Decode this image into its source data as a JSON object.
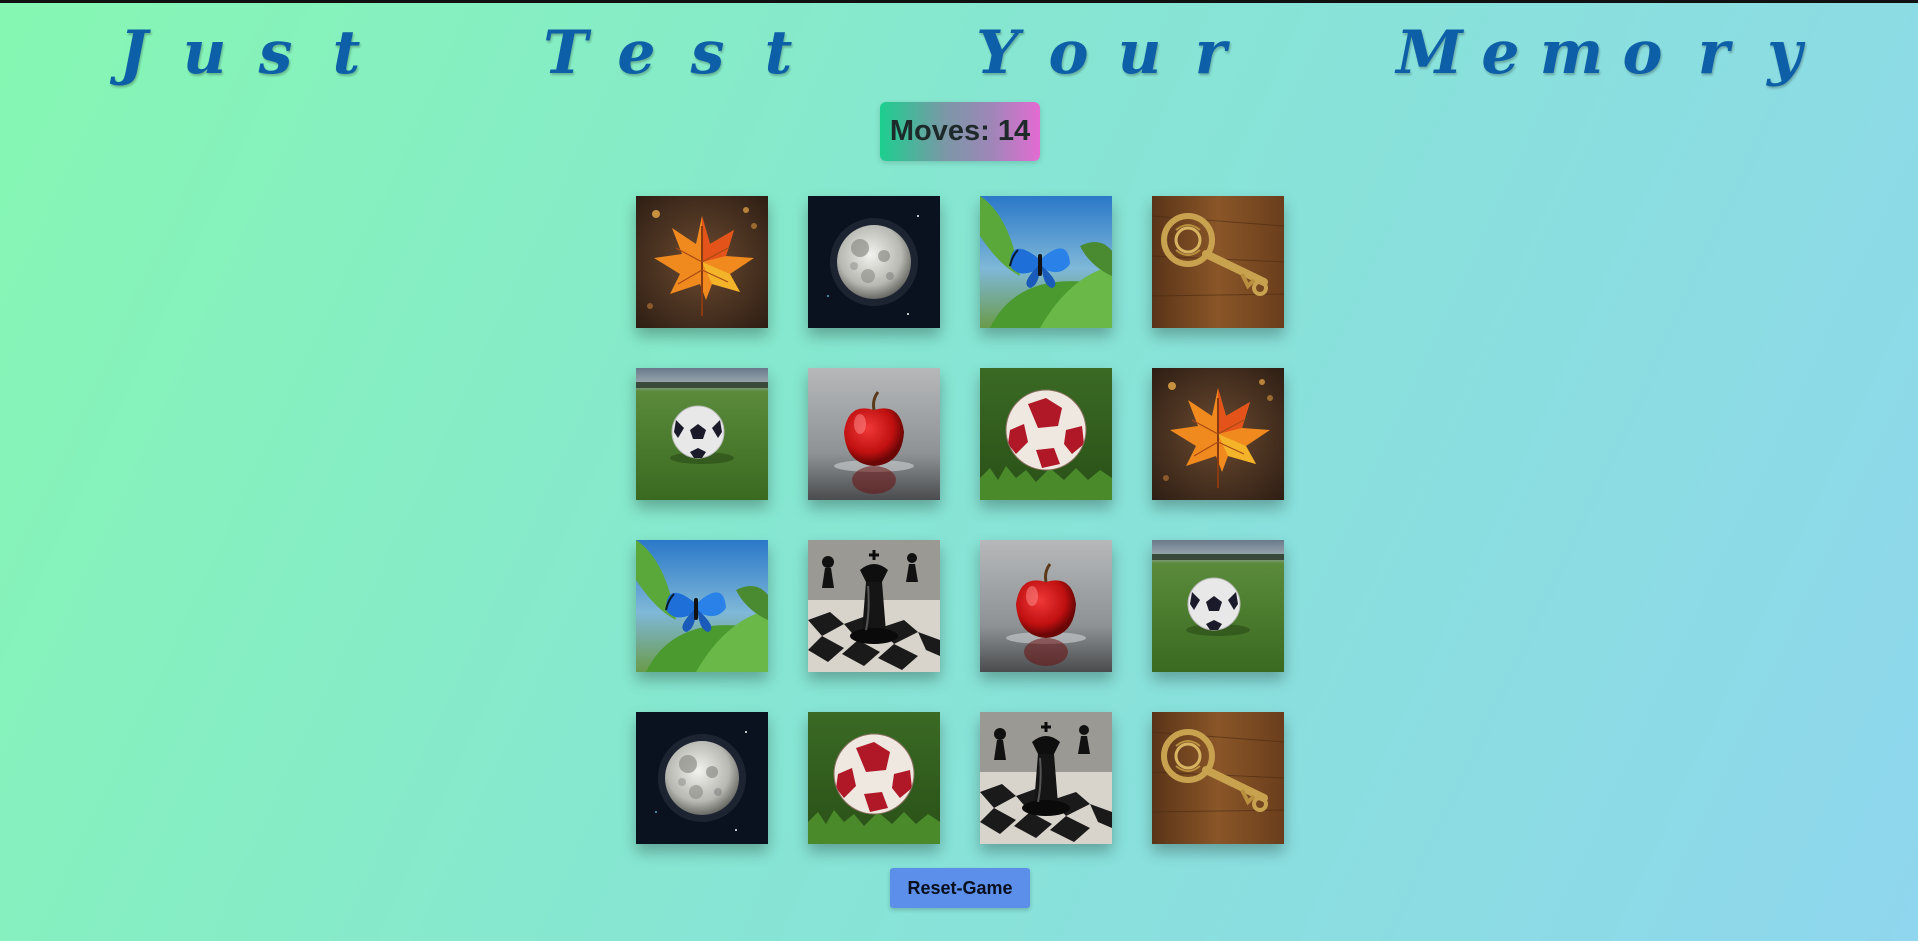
{
  "header": {
    "title_words": [
      "Just",
      "Test",
      "Your",
      "Memory"
    ]
  },
  "status": {
    "moves_label": "Moves:",
    "moves_value": "14"
  },
  "board": {
    "rows": 4,
    "cols": 4,
    "cards": [
      "maple-leaf",
      "full-moon",
      "blue-butterfly",
      "ornate-key",
      "soccer-ball-white",
      "red-apple",
      "soccer-ball-red",
      "maple-leaf",
      "blue-butterfly",
      "chess-king",
      "red-apple",
      "soccer-ball-white",
      "full-moon",
      "soccer-ball-red",
      "chess-king",
      "ornate-key"
    ]
  },
  "controls": {
    "reset_label": "Reset-Game"
  },
  "colors": {
    "title": "#0d5fa8",
    "reset_button": "#5b8fea"
  }
}
